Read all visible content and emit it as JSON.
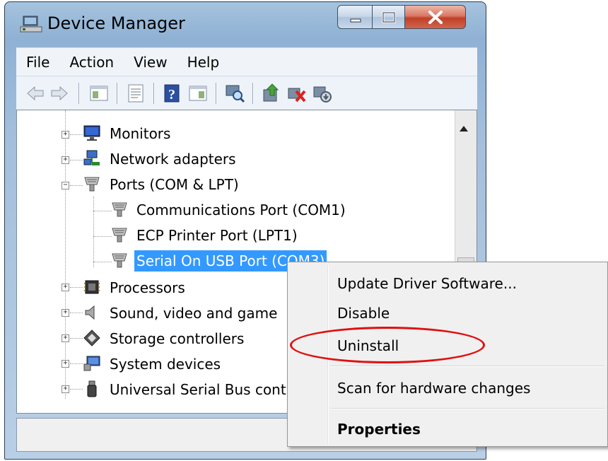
{
  "window": {
    "title": "Device Manager"
  },
  "menu": [
    "File",
    "Action",
    "View",
    "Help"
  ],
  "toolbar": {
    "icons": [
      "back-icon",
      "forward-icon",
      "show-hide-tree-icon",
      "properties-icon",
      "help-icon",
      "action-pane-icon",
      "scan-hardware-icon",
      "update-driver-icon",
      "uninstall-icon",
      "disable-icon"
    ]
  },
  "tree": {
    "items": [
      {
        "label": "Monitors"
      },
      {
        "label": "Network adapters"
      },
      {
        "label": "Ports (COM & LPT)"
      },
      {
        "label": "Communications Port (COM1)"
      },
      {
        "label": "ECP Printer Port (LPT1)"
      },
      {
        "label": "Serial On USB Port (COM3)"
      },
      {
        "label": "Processors"
      },
      {
        "label": "Sound, video and game"
      },
      {
        "label": "Storage controllers"
      },
      {
        "label": "System devices"
      },
      {
        "label": "Universal Serial Bus cont"
      }
    ]
  },
  "context_menu": {
    "update": "Update Driver Software...",
    "disable": "Disable",
    "uninstall": "Uninstall",
    "scan": "Scan for hardware changes",
    "properties": "Properties"
  },
  "colors": {
    "selection": "#3399ff",
    "highlight_ellipse": "#e01010"
  }
}
